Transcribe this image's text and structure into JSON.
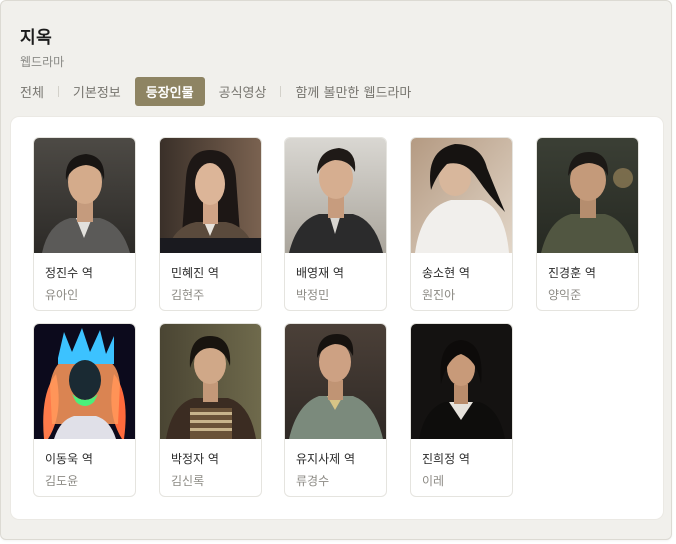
{
  "header": {
    "title": "지옥",
    "subtitle": "웹드라마"
  },
  "tabs": [
    {
      "label": "전체",
      "active": false
    },
    {
      "label": "기본정보",
      "active": false
    },
    {
      "label": "등장인물",
      "active": true
    },
    {
      "label": "공식영상",
      "active": false
    },
    {
      "label": "함께 볼만한 웹드라마",
      "active": false
    }
  ],
  "colors": {
    "active_tab": "#8e8463",
    "panel_bg": "#f1f0ec"
  },
  "cast": [
    {
      "role": "정진수 역",
      "actor": "유아인"
    },
    {
      "role": "민혜진 역",
      "actor": "김현주"
    },
    {
      "role": "배영재 역",
      "actor": "박정민"
    },
    {
      "role": "송소현 역",
      "actor": "원진아"
    },
    {
      "role": "진경훈 역",
      "actor": "양익준"
    },
    {
      "role": "이동욱 역",
      "actor": "김도윤"
    },
    {
      "role": "박정자 역",
      "actor": "김신록"
    },
    {
      "role": "유지사제 역",
      "actor": "류경수"
    },
    {
      "role": "진희정 역",
      "actor": "이레"
    }
  ]
}
